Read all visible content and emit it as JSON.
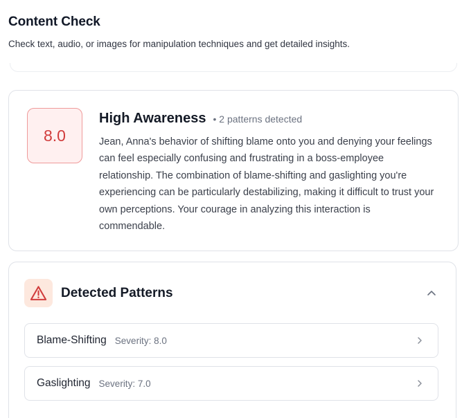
{
  "header": {
    "title": "Content Check",
    "subtitle": "Check text, audio, or images for manipulation techniques and get detailed insights."
  },
  "summary": {
    "score": "8.0",
    "awareness_label": "High Awareness",
    "patterns_detected": "• 2 patterns detected",
    "text": "Jean, Anna's behavior of shifting blame onto you and denying your feelings can feel especially confusing and frustrating in a boss-employee relationship. The combination of blame-shifting and gaslighting you're experiencing can be particularly destabilizing, making it difficult to trust your own perceptions. Your courage in analyzing this interaction is commendable."
  },
  "patterns_section": {
    "title": "Detected Patterns",
    "icon": "warning-triangle-icon",
    "items": [
      {
        "name": "Blame-Shifting",
        "severity": "Severity: 8.0"
      },
      {
        "name": "Gaslighting",
        "severity": "Severity: 7.0"
      }
    ]
  },
  "colors": {
    "score_text": "#d13c3c",
    "score_bg": "#fff0f0",
    "score_border": "#ef9a9a",
    "warning_bg": "#fde8de",
    "warning_stroke": "#d13c3c"
  }
}
